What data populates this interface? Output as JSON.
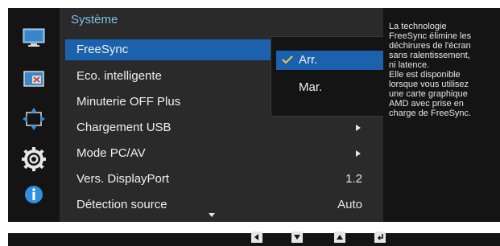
{
  "menu": {
    "title": "Système",
    "items": [
      {
        "label": "FreeSync",
        "value": "",
        "arrow": false
      },
      {
        "label": "Eco. intelligente",
        "value": "",
        "arrow": false
      },
      {
        "label": "Minuterie OFF Plus",
        "value": "",
        "arrow": false
      },
      {
        "label": "Chargement USB",
        "value": "",
        "arrow": true
      },
      {
        "label": "Mode PC/AV",
        "value": "",
        "arrow": true
      },
      {
        "label": "Vers. DisplayPort",
        "value": "1.2",
        "arrow": false
      },
      {
        "label": "Détection source",
        "value": "Auto",
        "arrow": false
      }
    ]
  },
  "submenu": {
    "options": [
      {
        "label": "Arr.",
        "checked": true
      },
      {
        "label": "Mar.",
        "checked": false
      }
    ]
  },
  "help": {
    "text": "La technologie\nFreeSync élimine les\ndéchirures de l'écran\nsans ralentissement,\nni latence.\nElle est disponible\nlorsque vous utilisez\nune carte graphique\nAMD avec prise en\ncharge de FreeSync."
  },
  "icons": {
    "rail": [
      "monitor-icon",
      "picture-in-picture-icon",
      "resize-arrows-icon",
      "gear-icon",
      "info-icon"
    ],
    "keys": [
      "left-key-icon",
      "down-key-icon",
      "up-key-icon",
      "enter-key-icon"
    ]
  },
  "colors": {
    "accent": "#1c61ad",
    "title": "#7fc1ea",
    "panel": "#2a2a2a",
    "dark": "#141414"
  }
}
